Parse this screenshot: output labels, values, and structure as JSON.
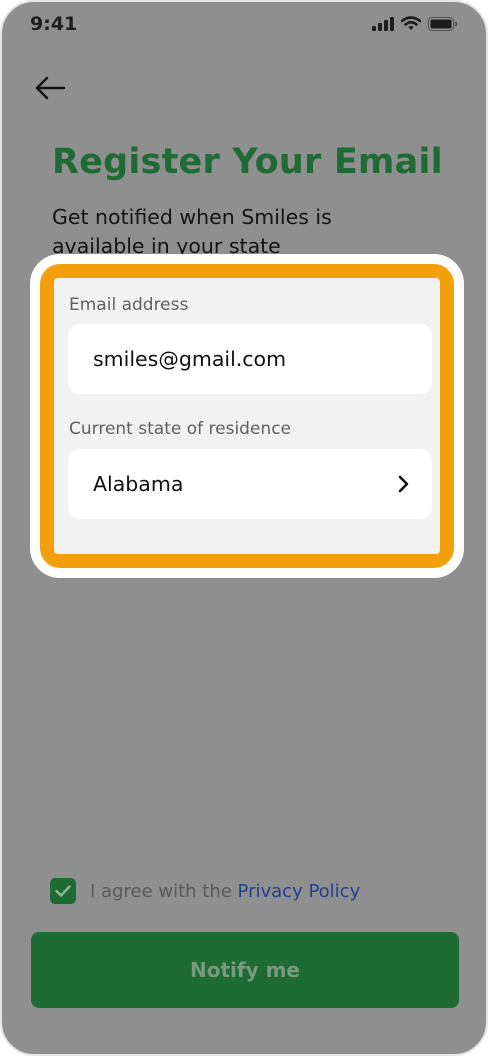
{
  "status_bar": {
    "time": "9:41"
  },
  "page": {
    "title": "Register Your Email",
    "subtitle": "Get notified when Smiles is available in your state"
  },
  "form": {
    "email": {
      "label": "Email address",
      "value": "smiles@gmail.com"
    },
    "state": {
      "label": "Current state of residence",
      "value": "Alabama"
    }
  },
  "consent": {
    "text": "I agree with the ",
    "link": "Privacy Policy",
    "checked": true
  },
  "notify_button": {
    "label": "Notify me"
  },
  "colors": {
    "brand_green": "#1e6b35",
    "highlight": "#f3a00c",
    "link_blue": "#233f8f"
  }
}
